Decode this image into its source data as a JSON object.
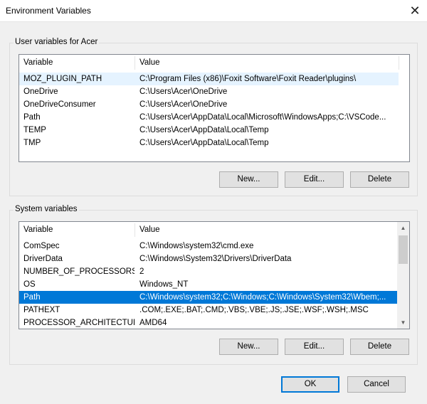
{
  "window": {
    "title": "Environment Variables",
    "close_glyph": "✕"
  },
  "user_group": {
    "label": "User variables for Acer",
    "columns": [
      "Variable",
      "Value"
    ],
    "rows": [
      {
        "variable": "MOZ_PLUGIN_PATH",
        "value": "C:\\Program Files (x86)\\Foxit Software\\Foxit Reader\\plugins\\"
      },
      {
        "variable": "OneDrive",
        "value": "C:\\Users\\Acer\\OneDrive"
      },
      {
        "variable": "OneDriveConsumer",
        "value": "C:\\Users\\Acer\\OneDrive"
      },
      {
        "variable": "Path",
        "value": "C:\\Users\\Acer\\AppData\\Local\\Microsoft\\WindowsApps;C:\\VSCode..."
      },
      {
        "variable": "TEMP",
        "value": "C:\\Users\\Acer\\AppData\\Local\\Temp"
      },
      {
        "variable": "TMP",
        "value": "C:\\Users\\Acer\\AppData\\Local\\Temp"
      }
    ],
    "buttons": {
      "new": "New...",
      "edit": "Edit...",
      "delete": "Delete"
    }
  },
  "system_group": {
    "label": "System variables",
    "columns": [
      "Variable",
      "Value"
    ],
    "rows": [
      {
        "variable": "ComSpec",
        "value": "C:\\Windows\\system32\\cmd.exe"
      },
      {
        "variable": "DriverData",
        "value": "C:\\Windows\\System32\\Drivers\\DriverData"
      },
      {
        "variable": "NUMBER_OF_PROCESSORS",
        "value": "2"
      },
      {
        "variable": "OS",
        "value": "Windows_NT"
      },
      {
        "variable": "Path",
        "value": "C:\\Windows\\system32;C:\\Windows;C:\\Windows\\System32\\Wbem;..."
      },
      {
        "variable": "PATHEXT",
        "value": ".COM;.EXE;.BAT;.CMD;.VBS;.VBE;.JS;.JSE;.WSF;.WSH;.MSC"
      },
      {
        "variable": "PROCESSOR_ARCHITECTURE",
        "value": "AMD64"
      }
    ],
    "selected_row": "Path",
    "buttons": {
      "new": "New...",
      "edit": "Edit...",
      "delete": "Delete"
    }
  },
  "footer": {
    "ok": "OK",
    "cancel": "Cancel"
  },
  "colors": {
    "selection": "#0078d7",
    "focus_border": "#0078d7"
  }
}
